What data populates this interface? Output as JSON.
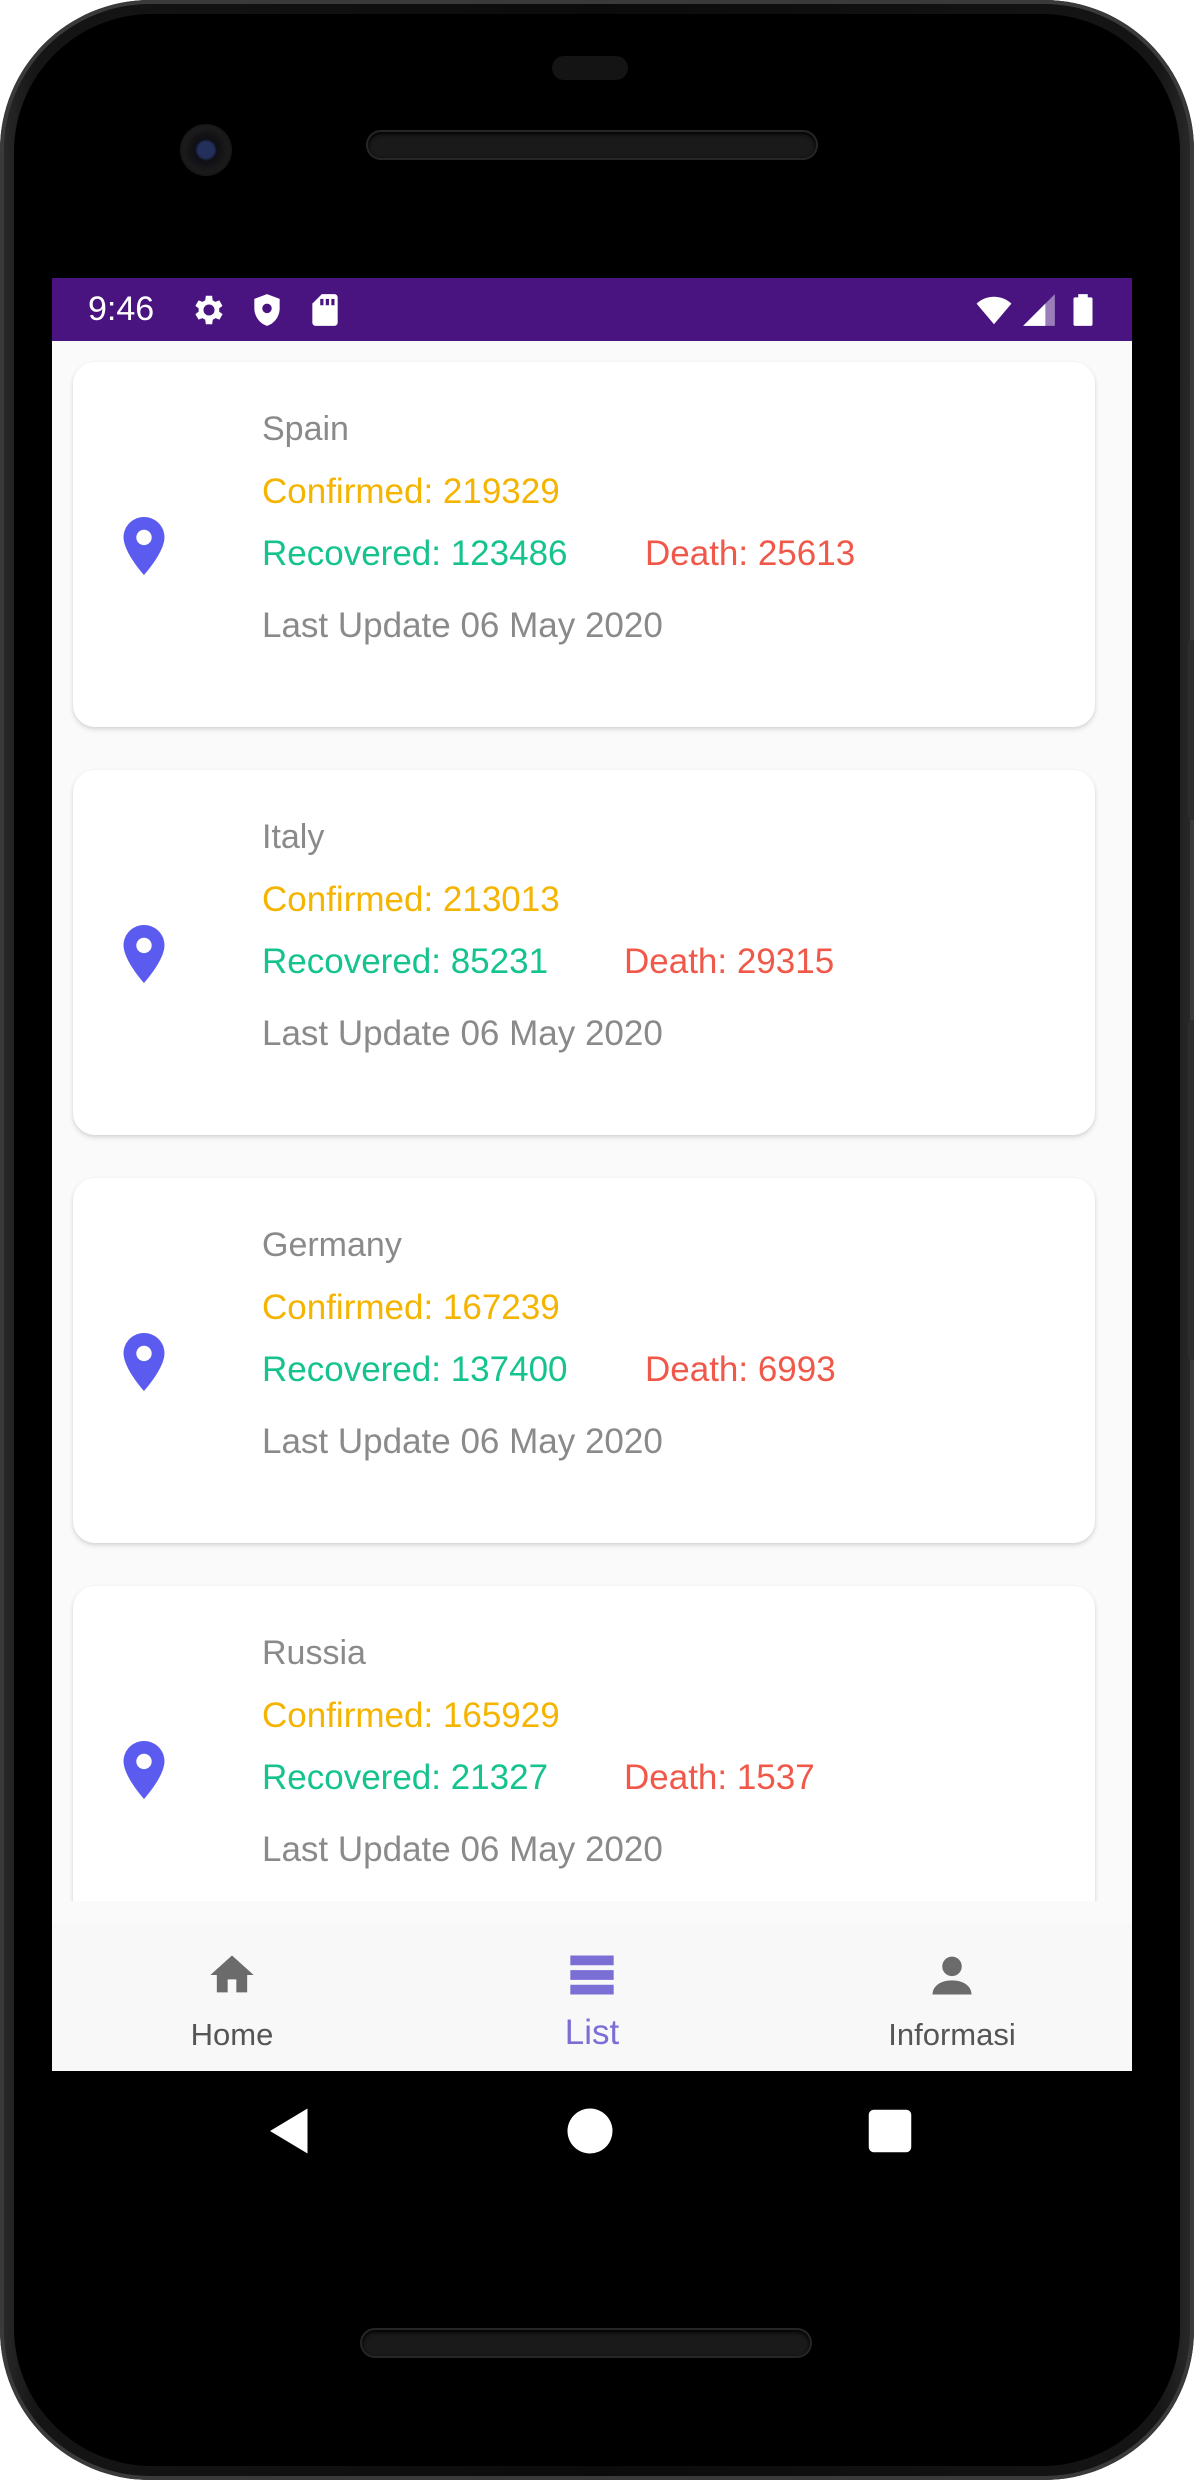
{
  "status_bar": {
    "time": "9:46",
    "left_icons": [
      "gear-icon",
      "shield-icon",
      "sd-card-icon"
    ],
    "right_icons": [
      "wifi-icon",
      "signal-icon",
      "battery-icon"
    ],
    "background": "#4a1480"
  },
  "cards": [
    {
      "country": "Spain",
      "confirmed": "Confirmed: 219329",
      "recovered": "Recovered: 123486",
      "death": "Death: 25613",
      "last_update": "Last Update 06 May 2020"
    },
    {
      "country": "Italy",
      "confirmed": "Confirmed: 213013",
      "recovered": "Recovered: 85231",
      "death": "Death: 29315",
      "last_update": "Last Update 06 May 2020"
    },
    {
      "country": "Germany",
      "confirmed": "Confirmed: 167239",
      "recovered": "Recovered: 137400",
      "death": "Death: 6993",
      "last_update": "Last Update 06 May 2020"
    },
    {
      "country": "Russia",
      "confirmed": "Confirmed: 165929",
      "recovered": "Recovered: 21327",
      "death": "Death: 1537",
      "last_update": "Last Update 06 May 2020"
    }
  ],
  "bottom_nav": {
    "items": [
      {
        "label": "Home",
        "icon": "home-icon",
        "active": false
      },
      {
        "label": "List",
        "icon": "list-icon",
        "active": true
      },
      {
        "label": "Informasi",
        "icon": "person-icon",
        "active": false
      }
    ]
  },
  "colors": {
    "confirmed": "#f5b400",
    "recovered": "#14c38e",
    "death": "#f0584a",
    "pin": "#5b5bf0",
    "active_nav": "#7b6fd6"
  },
  "android_nav": [
    "back-icon",
    "home-circle-icon",
    "recents-icon"
  ]
}
